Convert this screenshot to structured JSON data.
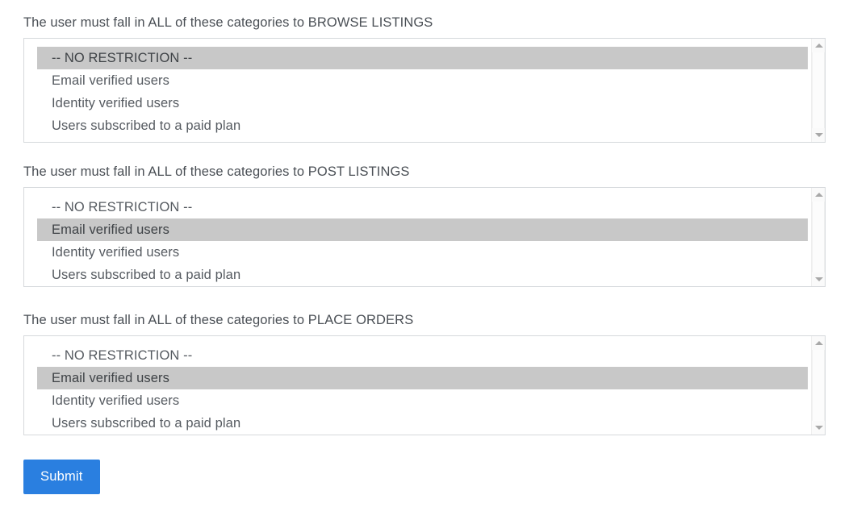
{
  "page": {
    "background_color": "#ffffff",
    "text_color": "#555a60",
    "selected_background_color": "#c8c8c8",
    "accent_color": "#2a7fe0"
  },
  "groups": [
    {
      "label": "The user must fall in ALL of these categories to BROWSE LISTINGS",
      "name": "browse-listings",
      "options": [
        {
          "label": "-- NO RESTRICTION --",
          "selected": true
        },
        {
          "label": "Email verified users",
          "selected": false
        },
        {
          "label": "Identity verified users",
          "selected": false
        },
        {
          "label": "Users subscribed to a paid plan",
          "selected": false
        }
      ],
      "scrollbar": {
        "up_icon": "scroll-up-arrow-icon",
        "down_icon": "scroll-down-arrow-icon"
      }
    },
    {
      "label": "The user must fall in ALL of these categories to POST LISTINGS",
      "name": "post-listings",
      "options": [
        {
          "label": "-- NO RESTRICTION --",
          "selected": false
        },
        {
          "label": "Email verified users",
          "selected": true
        },
        {
          "label": "Identity verified users",
          "selected": false
        },
        {
          "label": "Users subscribed to a paid plan",
          "selected": false
        }
      ],
      "scrollbar": {
        "up_icon": "scroll-up-arrow-icon",
        "down_icon": "scroll-down-arrow-icon"
      }
    },
    {
      "label": "The user must fall in ALL of these categories to PLACE ORDERS",
      "name": "place-orders",
      "options": [
        {
          "label": "-- NO RESTRICTION --",
          "selected": false
        },
        {
          "label": "Email verified users",
          "selected": true
        },
        {
          "label": "Identity verified users",
          "selected": false
        },
        {
          "label": "Users subscribed to a paid plan",
          "selected": false
        }
      ],
      "scrollbar": {
        "up_icon": "scroll-up-arrow-icon",
        "down_icon": "scroll-down-arrow-icon"
      }
    }
  ],
  "submit": {
    "label": "Submit"
  }
}
